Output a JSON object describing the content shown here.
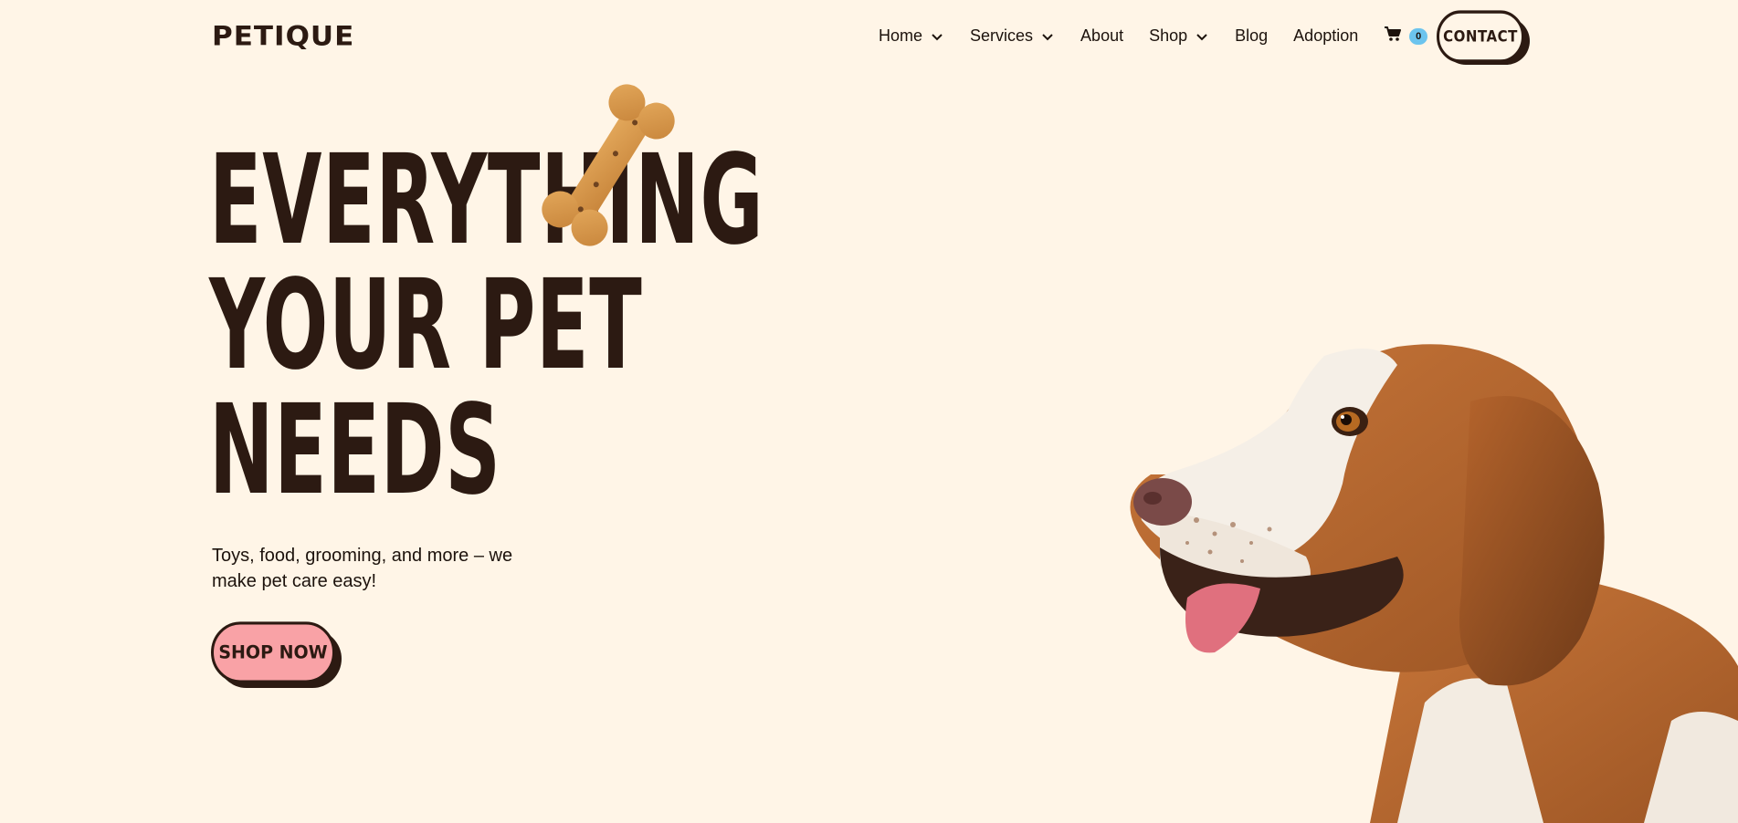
{
  "brand": {
    "logo_text": "PETIQUE"
  },
  "nav": {
    "items": [
      {
        "label": "Home",
        "has_dropdown": true
      },
      {
        "label": "Services",
        "has_dropdown": true
      },
      {
        "label": "About",
        "has_dropdown": false
      },
      {
        "label": "Shop",
        "has_dropdown": true
      },
      {
        "label": "Blog",
        "has_dropdown": false
      },
      {
        "label": "Adoption",
        "has_dropdown": false
      }
    ],
    "cart_icon": "cart-icon",
    "cart_count": "0",
    "contact_label": "CONTACT"
  },
  "hero": {
    "headline_lines": [
      "EVERYTHING",
      "YOUR PET",
      "NEEDS"
    ],
    "subtitle": "Toys, food, grooming, and more – we make pet care easy!",
    "cta_label": "SHOP NOW",
    "decorative_image": "dog-bone-biscuit",
    "hero_image": "beagle-dog"
  },
  "colors": {
    "background": "#fff5e7",
    "text_dark": "#2c1a12",
    "accent_pink": "#f9a2a6",
    "badge_blue": "#6cc4ee"
  }
}
